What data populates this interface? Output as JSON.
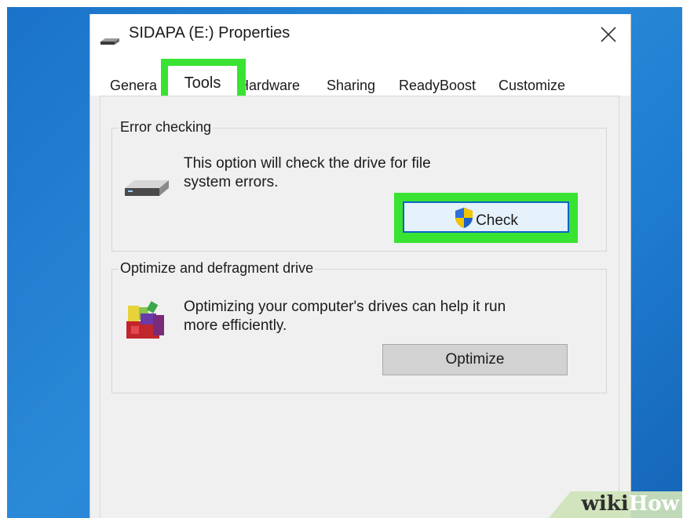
{
  "window": {
    "title": "SIDAPA (E:) Properties",
    "close_icon": "close-icon",
    "drive_icon": "drive-icon"
  },
  "tabs": [
    {
      "label": "General",
      "shown_text": "Genera"
    },
    {
      "label": "Tools",
      "active": true
    },
    {
      "label": "Hardware",
      "shown_text": "Hardware"
    },
    {
      "label": "Sharing"
    },
    {
      "label": "ReadyBoost"
    },
    {
      "label": "Customize"
    }
  ],
  "error_checking": {
    "group_label": "Error checking",
    "description_line1": "This option will check the drive for file",
    "description_line2": "system errors.",
    "button_label": "Check",
    "button_icon": "shield-icon",
    "icon": "hard-drive-icon"
  },
  "optimize": {
    "group_label": "Optimize and defragment drive",
    "description_line1": "Optimizing your computer's drives can help it run",
    "description_line2": "more efficiently.",
    "button_label": "Optimize",
    "icon": "defrag-icon"
  },
  "watermark": {
    "text_a": "wiki",
    "text_b": "How"
  },
  "colors": {
    "highlight": "#39e332",
    "desktop": "#1f7dd1",
    "window_bg": "#f0f0f0"
  }
}
